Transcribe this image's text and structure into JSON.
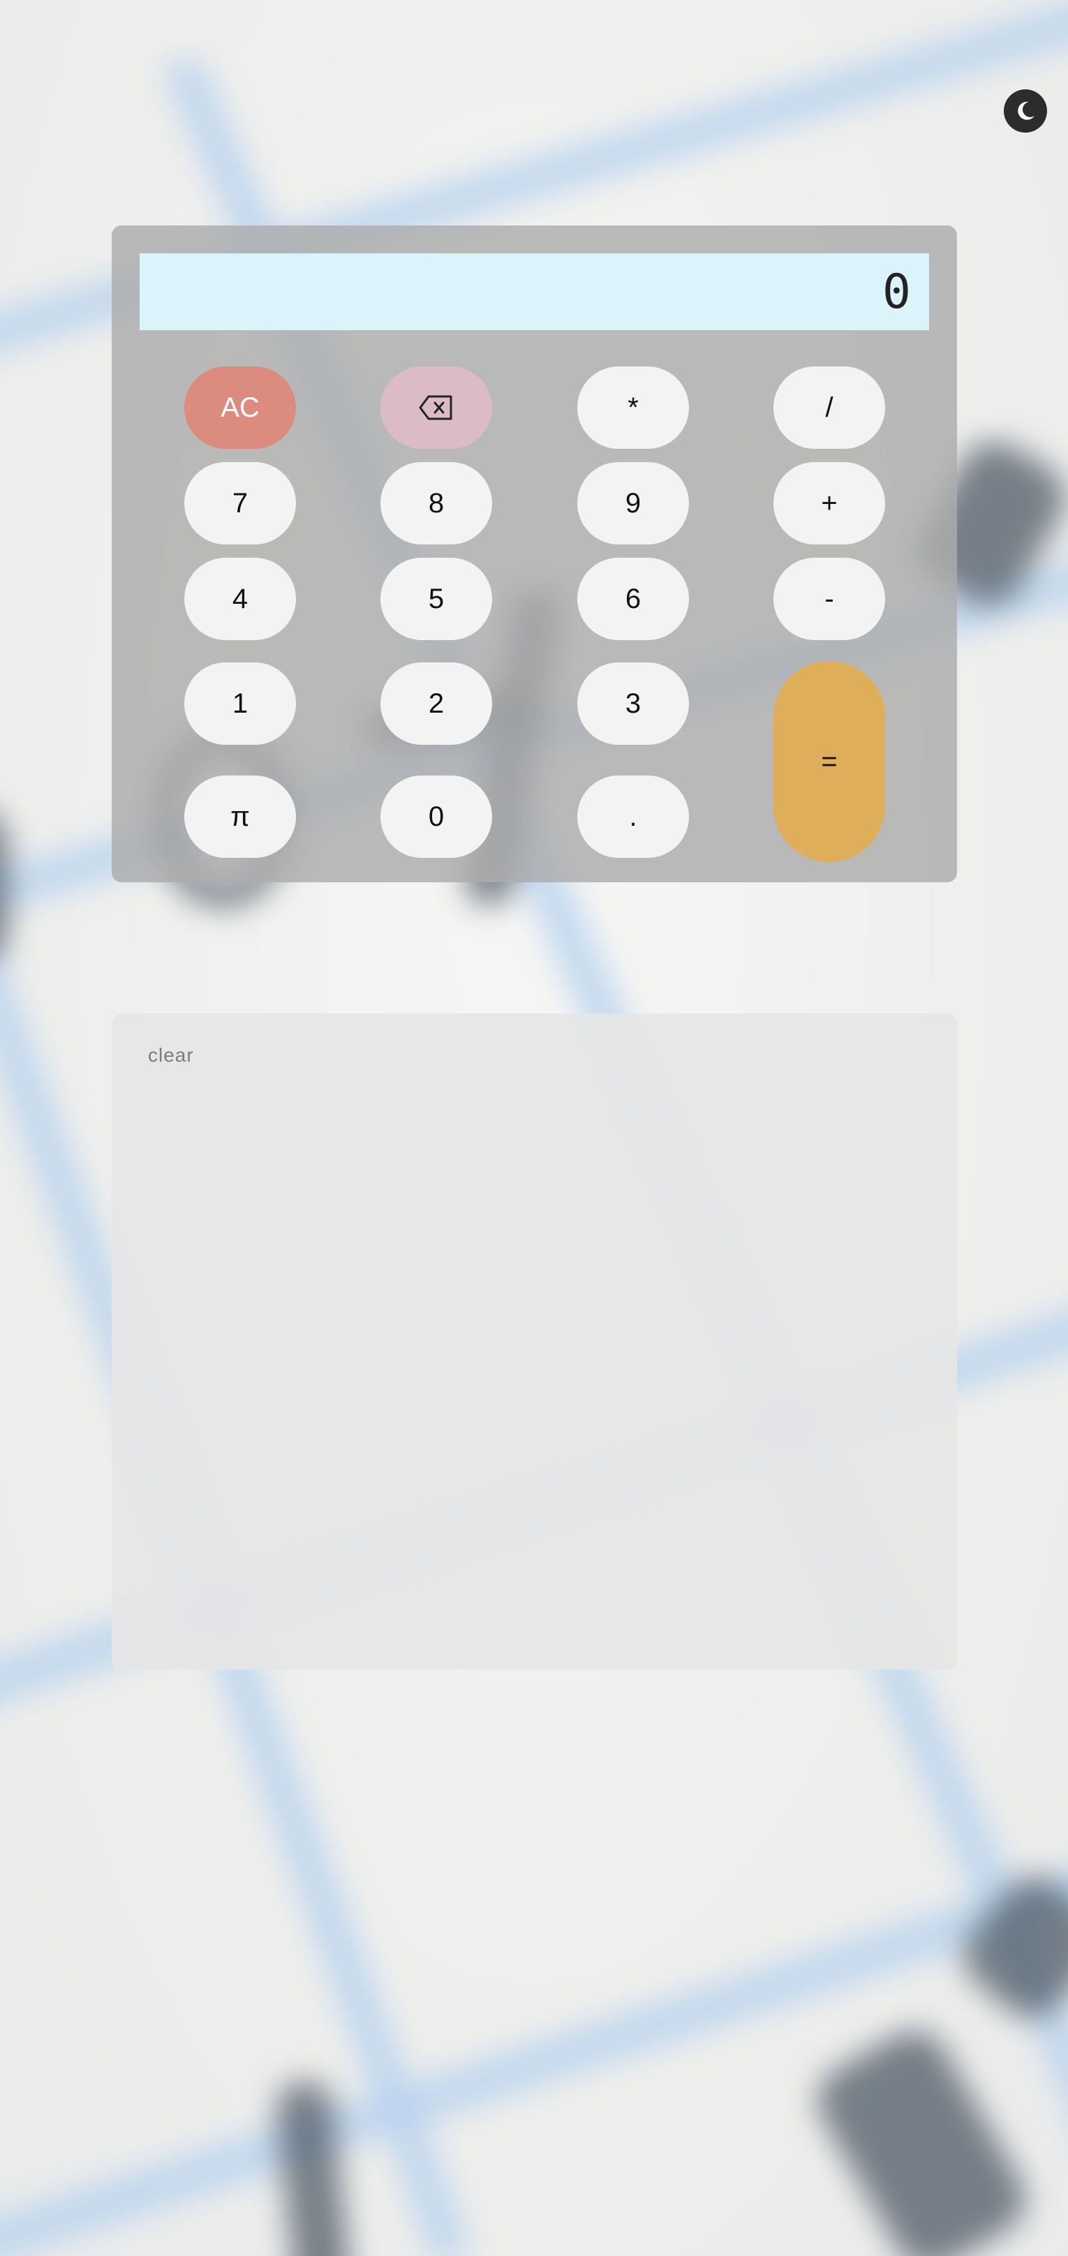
{
  "theme_toggle": {
    "icon": "moon-icon"
  },
  "display": {
    "value": "0"
  },
  "keys": {
    "ac": "AC",
    "backspace_icon": "backspace-icon",
    "multiply": "*",
    "divide": "/",
    "seven": "7",
    "eight": "8",
    "nine": "9",
    "plus": "+",
    "four": "4",
    "five": "5",
    "six": "6",
    "minus": "-",
    "one": "1",
    "two": "2",
    "three": "3",
    "equals": "=",
    "pi": "π",
    "zero": "0",
    "decimal": "."
  },
  "history": {
    "clear_label": "clear"
  },
  "colors": {
    "ac": "#dc8b7f",
    "backspace": "#dbbcc4",
    "equals": "#dfae5a",
    "display": "#dbf4fb",
    "calculator": "#acacac"
  }
}
